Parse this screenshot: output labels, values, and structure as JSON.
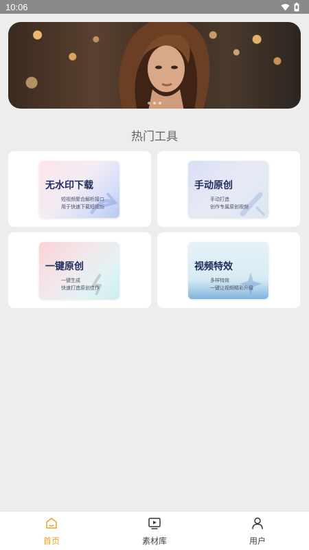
{
  "status": {
    "time": "10:06"
  },
  "banner": {
    "page_count": 3
  },
  "section": {
    "title": "热门工具"
  },
  "tools": [
    {
      "title": "无水印下载",
      "line1": "短视频聚合解析接口",
      "line2": "用于快速下载短视频"
    },
    {
      "title": "手动原创",
      "line1": "手动打造",
      "line2": "创作专属原创视频"
    },
    {
      "title": "一键原创",
      "line1": "一键生成",
      "line2": "快速打造原创佳作"
    },
    {
      "title": "视频特效",
      "line1": "多样特效",
      "line2": "一键让视频精彩升级"
    }
  ],
  "nav": [
    {
      "label": "首页",
      "icon": "home-icon",
      "active": true
    },
    {
      "label": "素材库",
      "icon": "video-library-icon",
      "active": false
    },
    {
      "label": "用户",
      "icon": "user-icon",
      "active": false
    }
  ],
  "colors": {
    "accent": "#f0a020",
    "background": "#ededed"
  }
}
